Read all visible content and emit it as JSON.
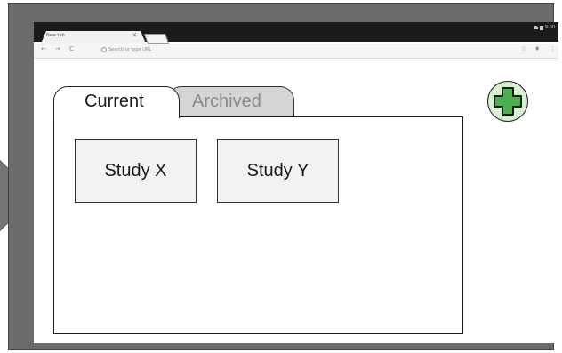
{
  "browser": {
    "tab_title": "New tab",
    "tab_close": "×",
    "omnibox_placeholder": "Search or type URL",
    "nav": {
      "back": "←",
      "forward": "→",
      "reload": "C"
    },
    "toolbar_right": {
      "star": "☆",
      "mic": "♦",
      "menu": "⋮"
    },
    "status_time": "9:00"
  },
  "content": {
    "tabs": [
      {
        "label": "Current",
        "active": true
      },
      {
        "label": "Archived",
        "active": false
      }
    ],
    "studies": [
      {
        "label": "Study X"
      },
      {
        "label": "Study Y"
      }
    ]
  },
  "add_button": {
    "icon": "plus-icon",
    "color": "#4caf50"
  },
  "colors": {
    "bezel": "#6b6b6b",
    "status_bar": "#1b1b1b",
    "archived_tab": "#d5d5d5",
    "add_button_bg": "#d7f0d0",
    "plus_green": "#4caf50"
  }
}
